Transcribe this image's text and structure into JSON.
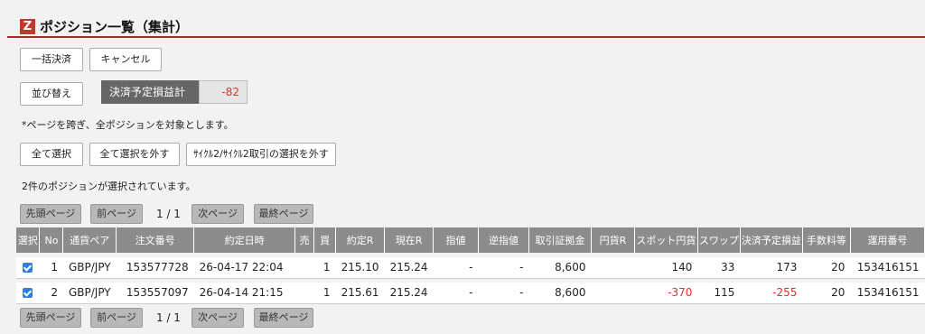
{
  "header": {
    "logo": "Z",
    "title": "ポジション一覧（集計）"
  },
  "buttons": {
    "bulk_settle": "一括決済",
    "cancel": "キャンセル",
    "sort": "並び替え",
    "select_all": "全て選択",
    "deselect_all": "全て選択を外す",
    "deselect_cycle": "ｻｲｸﾙ2/ｻｲｸﾙ2取引の選択を外す"
  },
  "pl_summary": {
    "label": "決済予定損益計",
    "value": "-82"
  },
  "notes": {
    "cross_page": "*ページを跨ぎ、全ポジションを対象とします。",
    "selected_count": "2件のポジションが選択されています。"
  },
  "pagination": {
    "first": "先頭ページ",
    "prev": "前ページ",
    "page_text": "1 / 1",
    "next": "次ページ",
    "last": "最終ページ"
  },
  "table": {
    "columns": [
      "選択",
      "No",
      "通貨ペア",
      "注文番号",
      "約定日時",
      "売",
      "買",
      "約定R",
      "現在R",
      "指値",
      "逆指値",
      "取引証拠金",
      "円貨R",
      "スポット円貨",
      "スワップ",
      "決済予定損益",
      "手数料等",
      "運用番号"
    ],
    "rows": [
      {
        "no": "1",
        "pair": "GBP/JPY",
        "order": "153577728",
        "datetime": "26-04-17 22:04",
        "sell": "",
        "buy": "1",
        "exec_rate": "215.10",
        "cur_rate": "215.24",
        "limit": "-",
        "stop": "-",
        "margin": "8,600",
        "yen_rate": "",
        "spot_yen": "140",
        "swap": "33",
        "pl": "173",
        "fee": "20",
        "op_no": "153416151"
      },
      {
        "no": "2",
        "pair": "GBP/JPY",
        "order": "153557097",
        "datetime": "26-04-14 21:15",
        "sell": "",
        "buy": "1",
        "exec_rate": "215.61",
        "cur_rate": "215.24",
        "limit": "-",
        "stop": "-",
        "margin": "8,600",
        "yen_rate": "",
        "spot_yen": "-370",
        "swap": "115",
        "pl": "-255",
        "fee": "20",
        "op_no": "153416151"
      }
    ]
  },
  "colors": {
    "accent_line": "#a52a2a",
    "logo": "#c0392b",
    "negative": "#e0322a",
    "header_bg": "#8c8c8c",
    "checkbox": "#2f7fd8"
  }
}
